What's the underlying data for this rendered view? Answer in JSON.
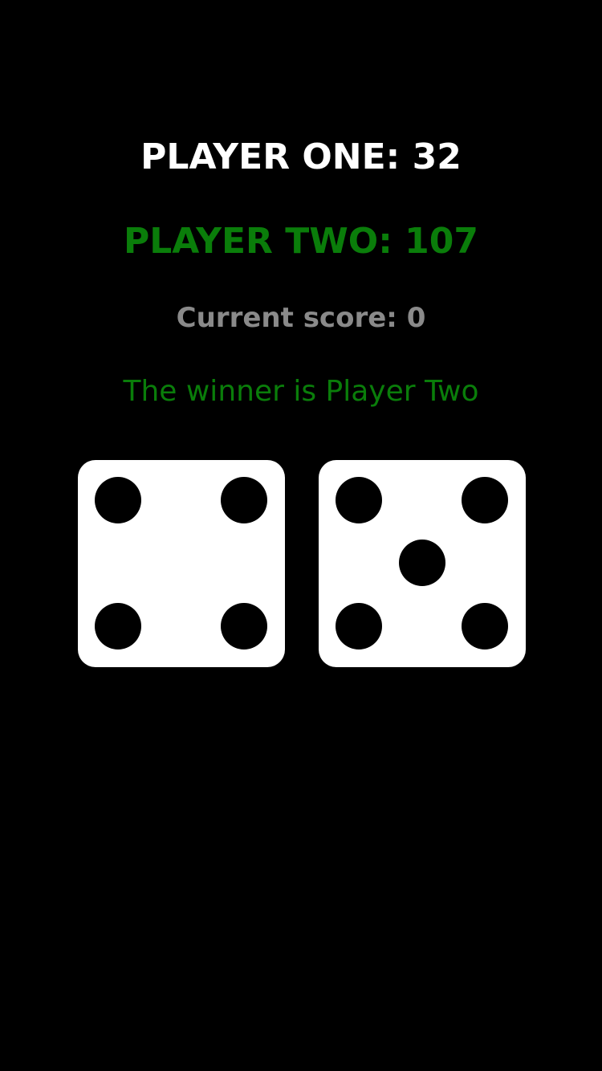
{
  "scoreboard": {
    "player_one": "PLAYER ONE: 32",
    "player_two": "PLAYER TWO: 107",
    "current_score": "Current score: 0",
    "winner_message": "The winner is Player Two"
  },
  "colors": {
    "background": "#000000",
    "player_one_text": "#ffffff",
    "player_two_text": "#0a7d0a",
    "current_score_text": "#8a8a8a",
    "winner_text": "#0a7d0a",
    "die_face": "#ffffff",
    "die_pip": "#000000"
  },
  "dice": [
    {
      "value": 4
    },
    {
      "value": 5
    }
  ]
}
